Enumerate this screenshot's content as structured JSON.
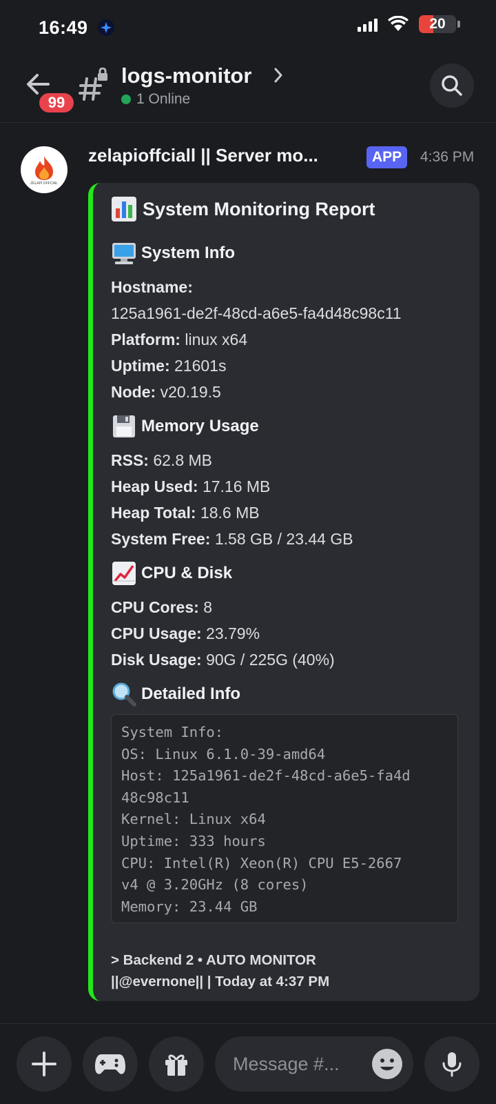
{
  "status_bar": {
    "time": "16:49",
    "battery": "20",
    "icons": [
      "assistant-star-icon",
      "signal-icon",
      "wifi-icon",
      "battery-icon"
    ]
  },
  "header": {
    "unread_badge": "99",
    "channel_name": "logs-monitor",
    "online_text": "1 Online",
    "icons": [
      "back-arrow-icon",
      "locked-channel-hash-icon",
      "chevron-right-icon",
      "search-icon"
    ]
  },
  "message": {
    "author": "zelapioffciall || Server mo...",
    "app_tag": "APP",
    "time": "4:36 PM",
    "avatar_caption": "ZELAPI OFFCIAL",
    "embed": {
      "accent_color": "#22e81a",
      "title": "System Monitoring Report",
      "sections": {
        "system_info": {
          "heading": "System Info",
          "hostname_label": "Hostname:",
          "hostname_value": "125a1961-de2f-48cd-a6e5-fa4d48c98c11",
          "platform_label": "Platform:",
          "platform_value": "linux x64",
          "uptime_label": "Uptime:",
          "uptime_value": "21601s",
          "node_label": "Node:",
          "node_value": "v20.19.5"
        },
        "memory": {
          "heading": "Memory Usage",
          "rss_label": "RSS:",
          "rss_value": "62.8 MB",
          "heap_used_label": "Heap Used:",
          "heap_used_value": "17.16 MB",
          "heap_total_label": "Heap Total:",
          "heap_total_value": "18.6 MB",
          "system_free_label": "System Free:",
          "system_free_value": "1.58 GB / 23.44 GB"
        },
        "cpu_disk": {
          "heading": "CPU & Disk",
          "cores_label": "CPU Cores:",
          "cores_value": "8",
          "usage_label": "CPU Usage:",
          "usage_value": "23.79%",
          "disk_label": "Disk Usage:",
          "disk_value": "90G / 225G (40%)"
        },
        "detailed": {
          "heading": "Detailed Info",
          "code_lines": [
            "System Info:",
            "OS: Linux 6.1.0-39-amd64",
            "Host: 125a1961-de2f-48cd-a6e5-fa4d",
            "48c98c11",
            "Kernel: Linux x64",
            "Uptime: 333 hours",
            "CPU: Intel(R) Xeon(R) CPU E5-2667",
            "v4 @ 3.20GHz (8 cores)",
            "Memory: 23.44 GB"
          ]
        }
      },
      "footer_line1": "> Backend 2 • AUTO MONITOR",
      "footer_line2": "||@evernone|| | Today at 4:37 PM"
    }
  },
  "composer": {
    "placeholder": "Message #...",
    "icons": [
      "plus-icon",
      "gamepad-icon",
      "gift-icon",
      "emoji-icon",
      "microphone-icon"
    ]
  }
}
